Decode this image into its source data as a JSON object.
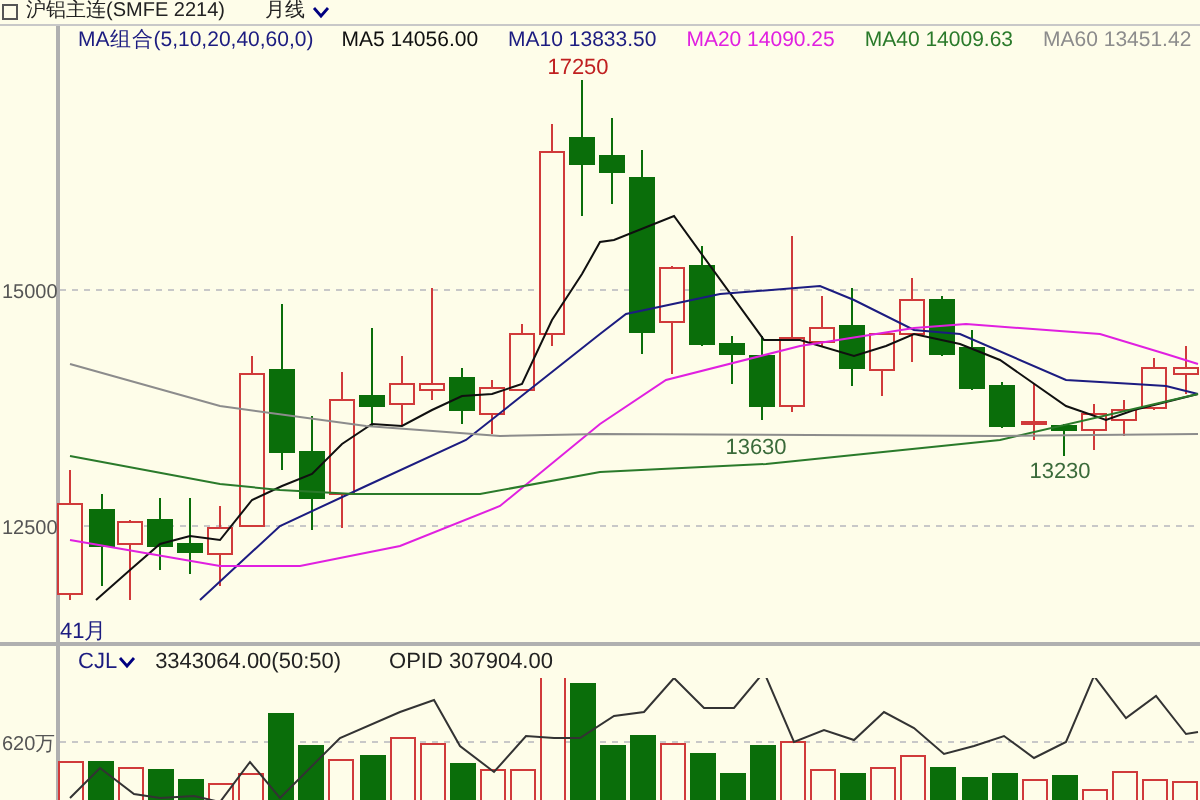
{
  "title_bar": {
    "symbol": "沪铝主连(SMFE 2214)",
    "period": "月线"
  },
  "indicator_bar": {
    "group": "MA组合(5,10,20,40,60,0)",
    "averages": [
      {
        "label": "MA5 14056.00",
        "color": "#101010"
      },
      {
        "label": "MA10 13833.50",
        "color": "#1c1c80"
      },
      {
        "label": "MA20 14090.25",
        "color": "#e020e0"
      },
      {
        "label": "MA40 14009.63",
        "color": "#2a7a2a"
      },
      {
        "label": "MA60 13451.42",
        "color": "#8c8c8c"
      }
    ]
  },
  "price_chart": {
    "y_axis_labels": [
      "15000",
      "12500"
    ],
    "high_label": "17250",
    "low_labels": [
      "13630",
      "13230"
    ],
    "x_axis_label": "41月"
  },
  "volume_bar": {
    "indicator": "CJL",
    "volume": "3343064.00(50:50)",
    "open_interest": "OPID 307904.00"
  },
  "volume_chart": {
    "y_axis_label": "620万"
  }
}
